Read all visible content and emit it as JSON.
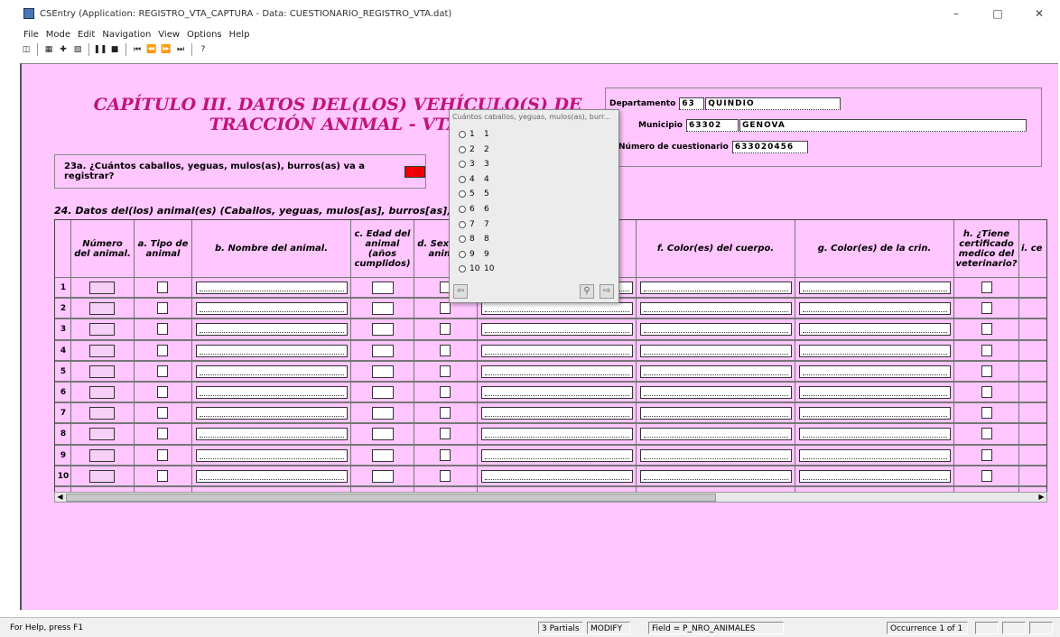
{
  "window": {
    "title": "CSEntry (Application: REGISTRO_VTA_CAPTURA - Data: CUESTIONARIO_REGISTRO_VTA.dat)",
    "minimize": "–",
    "maximize": "□",
    "close": "✕"
  },
  "menu": [
    "File",
    "Mode",
    "Edit",
    "Navigation",
    "View",
    "Options",
    "Help"
  ],
  "chapter_title": "CAPÍTULO III. DATOS DEL(LOS) VEHÍCULO(S) DE TRACCIÓN ANIMAL - VTA.",
  "q23": {
    "label": "23a. ¿Cuántos caballos, yeguas, mulos(as), burros(as) va a registrar?"
  },
  "identification": {
    "departamento_label": "Departamento",
    "departamento_code": "63",
    "departamento_name": "QUINDIO",
    "municipio_label": "Municipio",
    "municipio_code": "63302",
    "municipio_name": "GENOVA",
    "cuestionario_label": "Número de cuestionario",
    "cuestionario_value": "633020456"
  },
  "section24_title": "24. Datos del(los) animal(es) (Caballos, yeguas, mulos[as], burros[as])",
  "grid": {
    "headers": {
      "numero": "Número del animal.",
      "tipo": "a. Tipo de animal",
      "nombre": "b. Nombre del animal.",
      "edad": "c. Edad del animal (años cumplidos)",
      "sexo": "d. Sexo del animal",
      "color_cuerpo": "f. Color(es) del cuerpo.",
      "color_crin": "g. Color(es) de la crin.",
      "certificado": "h. ¿Tiene certificado medico del veterinario?",
      "extra": "i. ce"
    },
    "rows": [
      "1",
      "2",
      "3",
      "4",
      "5",
      "6",
      "7",
      "8",
      "9",
      "10"
    ]
  },
  "popup": {
    "title": "Cuántos caballos, yeguas, mulos(as), burr...",
    "options": [
      {
        "code": "1",
        "label": "1"
      },
      {
        "code": "2",
        "label": "2"
      },
      {
        "code": "3",
        "label": "3"
      },
      {
        "code": "4",
        "label": "4"
      },
      {
        "code": "5",
        "label": "5"
      },
      {
        "code": "6",
        "label": "6"
      },
      {
        "code": "7",
        "label": "7"
      },
      {
        "code": "8",
        "label": "8"
      },
      {
        "code": "9",
        "label": "9"
      },
      {
        "code": "10",
        "label": "10"
      }
    ]
  },
  "status": {
    "help": "For Help, press F1",
    "partials": "3 Partials",
    "mode": "MODIFY",
    "field": "Field = P_NRO_ANIMALES",
    "occurrence": "Occurrence 1 of 1"
  },
  "colors": {
    "form_bg": "#ffc6ff",
    "title_color": "#c0147c",
    "active_field": "#ee0000"
  }
}
